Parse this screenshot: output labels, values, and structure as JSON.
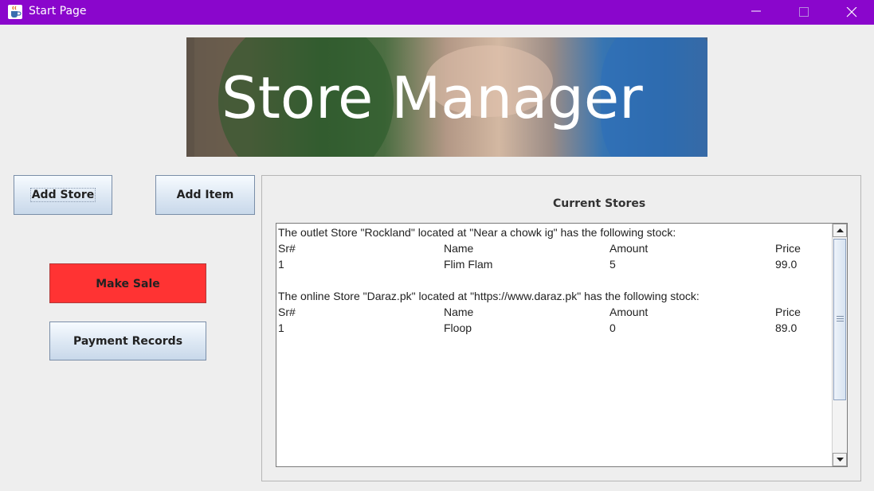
{
  "window": {
    "title": "Start Page",
    "icon": "java-cup-icon",
    "controls": [
      "minimize-icon",
      "maximize-icon",
      "close-icon"
    ],
    "titlebar_color": "#8a06cc"
  },
  "banner": {
    "text": "Store Manager"
  },
  "buttons": {
    "add_store": "Add Store",
    "add_item": "Add Item",
    "make_sale": "Make Sale",
    "payment_records": "Payment Records",
    "make_sale_color": "#ff3333"
  },
  "stores_panel": {
    "title": "Current Stores",
    "blocks": [
      {
        "header": "The outlet Store \"Rockland\" located at \"Near a chowk ig\" has the following stock:",
        "columns": [
          "Sr#",
          "Name",
          "Amount",
          "Price"
        ],
        "rows": [
          [
            "1",
            "Flim Flam",
            "5",
            "99.0"
          ]
        ]
      },
      {
        "header": "The online Store \"Daraz.pk\" located at \"https://www.daraz.pk\" has the following stock:",
        "columns": [
          "Sr#",
          "Name",
          "Amount",
          "Price"
        ],
        "rows": [
          [
            "1",
            "Floop",
            "0",
            "89.0"
          ]
        ]
      }
    ]
  }
}
